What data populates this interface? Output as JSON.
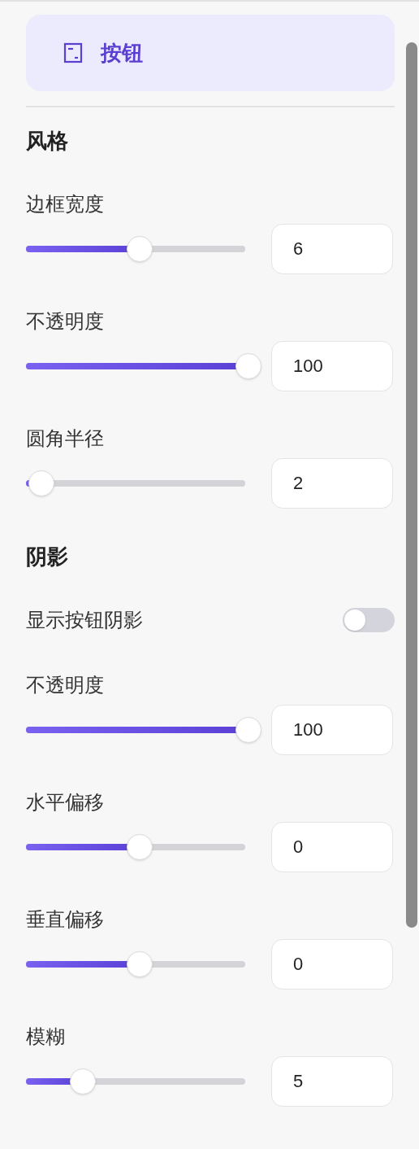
{
  "component_item": {
    "label": "按钮",
    "selected": true
  },
  "sections": [
    {
      "title": "风格",
      "rows": [
        {
          "kind": "slider",
          "label": "边框宽度",
          "level": 0.48,
          "value": "6"
        },
        {
          "kind": "slider",
          "label": "不透明度",
          "level": 1,
          "value": "100"
        },
        {
          "kind": "slider",
          "label": "圆角半径",
          "level": 0.01,
          "value": "2"
        }
      ]
    },
    {
      "title": "阴影",
      "rows": [
        {
          "kind": "toggle",
          "label": "显示按钮阴影",
          "on": false
        },
        {
          "kind": "slider",
          "label": "不透明度",
          "level": 1,
          "value": "100"
        },
        {
          "kind": "slider",
          "label": "水平偏移",
          "level": 0.48,
          "value": "0"
        },
        {
          "kind": "slider",
          "label": "垂直偏移",
          "level": 0.48,
          "value": "0"
        },
        {
          "kind": "slider",
          "label": "模糊",
          "level": 0.21,
          "value": "5"
        }
      ]
    }
  ]
}
